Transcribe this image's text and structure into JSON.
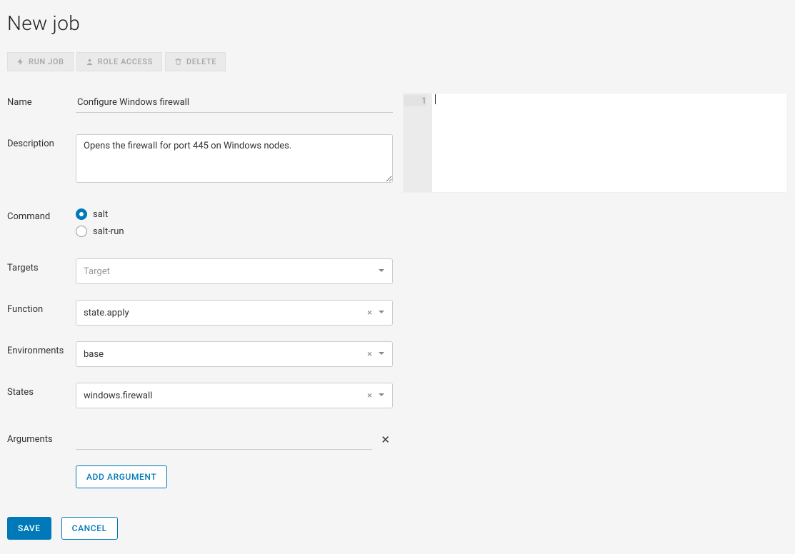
{
  "title": "New job",
  "toolbar": {
    "run_job": "RUN JOB",
    "role_access": "ROLE ACCESS",
    "delete": "DELETE"
  },
  "labels": {
    "name": "Name",
    "description": "Description",
    "command": "Command",
    "targets": "Targets",
    "function": "Function",
    "environments": "Environments",
    "states": "States",
    "arguments": "Arguments"
  },
  "fields": {
    "name_value": "Configure Windows firewall",
    "description_value": "Opens the firewall for port 445 on Windows nodes.",
    "command_options": {
      "salt": "salt",
      "salt_run": "salt-run"
    },
    "command_selected": "salt",
    "targets_placeholder": "Target",
    "function_value": "state.apply",
    "environments_value": "base",
    "states_value": "windows.firewall",
    "argument_value": ""
  },
  "buttons": {
    "add_argument": "ADD ARGUMENT",
    "save": "SAVE",
    "cancel": "CANCEL"
  },
  "editor": {
    "gutter": [
      "1"
    ],
    "content": ""
  }
}
